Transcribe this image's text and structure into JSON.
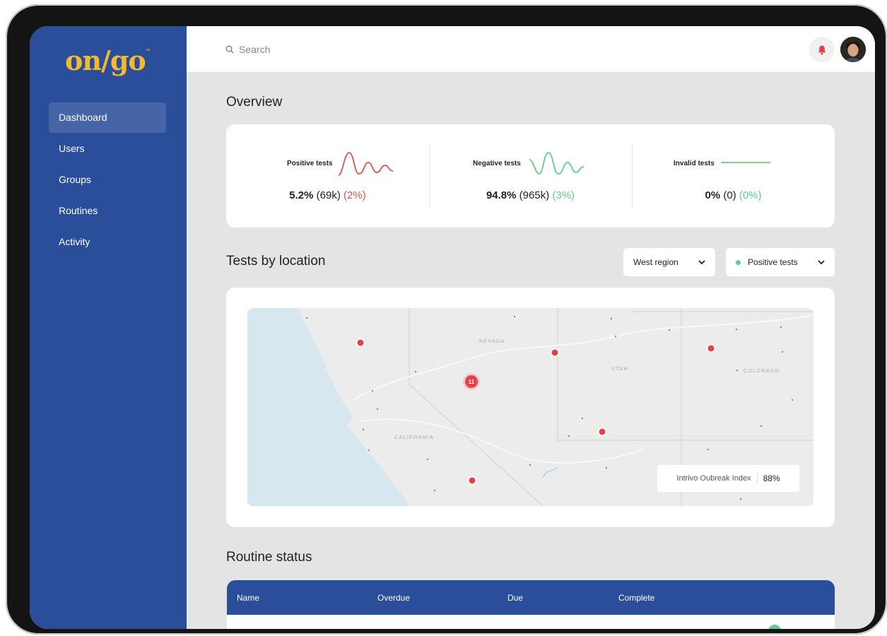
{
  "sidebar": {
    "logo": "on/go",
    "logo_mark": "™",
    "items": [
      {
        "label": "Dashboard",
        "active": true
      },
      {
        "label": "Users",
        "active": false
      },
      {
        "label": "Groups",
        "active": false
      },
      {
        "label": "Routines",
        "active": false
      },
      {
        "label": "Activity",
        "active": false
      }
    ]
  },
  "header": {
    "search_placeholder": "Search",
    "icons": [
      "search-icon",
      "bell-icon",
      "avatar"
    ]
  },
  "overview": {
    "title": "Overview",
    "stats": [
      {
        "label": "Positive tests",
        "percent": "5.2%",
        "count": "(69k)",
        "change": "(2%)",
        "color": "#d9534f"
      },
      {
        "label": "Negative tests",
        "percent": "94.8%",
        "count": "(965k)",
        "change": "(3%)",
        "color": "#5fcf87"
      },
      {
        "label": "Invalid tests",
        "percent": "0%",
        "count": "(0)",
        "change": "(0%)",
        "color": "#5fcf87"
      }
    ]
  },
  "location": {
    "title": "Tests by location",
    "region_select": "West region",
    "metric_select": "Positive tests",
    "map_labels": [
      "NEVADA",
      "UTAH",
      "COLORADO",
      "CALIFORNIA"
    ],
    "cluster_count": "11",
    "index_label": "Intrivo Oubreak Index",
    "index_value": "88%"
  },
  "routine": {
    "title": "Routine status",
    "columns": [
      "Name",
      "Overdue",
      "Due",
      "Complete"
    ]
  },
  "colors": {
    "sidebar": "#2b4e9b",
    "accent_gold": "#f2b830",
    "positive": "#d9534f",
    "negative": "#5fcf87",
    "alert": "#e5404a"
  }
}
